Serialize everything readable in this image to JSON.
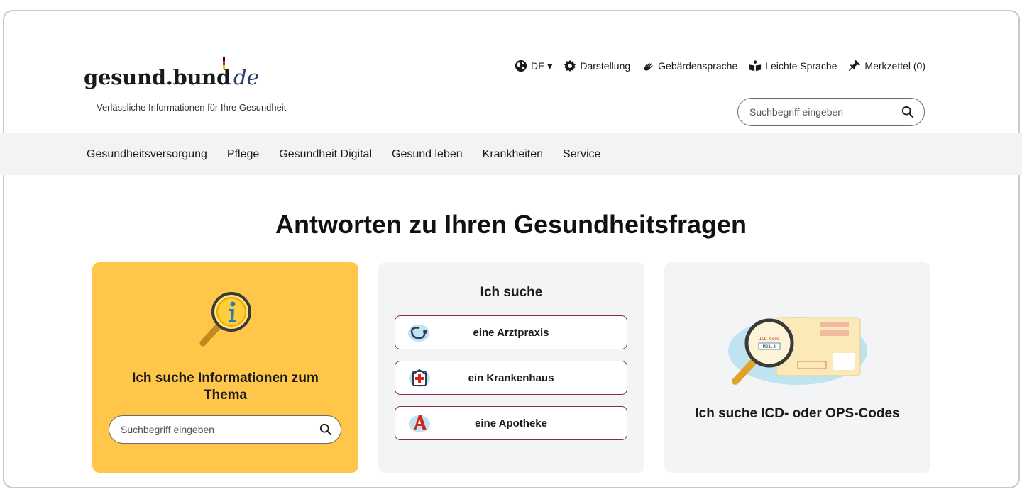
{
  "logo": {
    "word": "gesund.bund",
    "tld": "de",
    "tagline": "Verlässliche Informationen für Ihre Gesundheit"
  },
  "utility": [
    {
      "label": "DE ▾",
      "icon": "globe-icon"
    },
    {
      "label": "Darstellung",
      "icon": "gear-icon"
    },
    {
      "label": "Gebärdensprache",
      "icon": "sign-language-icon"
    },
    {
      "label": "Leichte Sprache",
      "icon": "easy-language-icon"
    },
    {
      "label": "Merkzettel (0)",
      "icon": "pin-icon"
    }
  ],
  "search_top": {
    "placeholder": "Suchbegriff eingeben"
  },
  "nav": [
    "Gesundheitsversorgung",
    "Pflege",
    "Gesundheit Digital",
    "Gesund leben",
    "Krankheiten",
    "Service"
  ],
  "headline": "Antworten zu Ihren Gesundheitsfragen",
  "cards": {
    "info": {
      "title": "Ich suche Informationen zum Thema",
      "search_placeholder": "Suchbegriff eingeben"
    },
    "finder": {
      "title": "Ich suche",
      "options": [
        {
          "label": "eine Arztpraxis",
          "icon": "stethoscope-icon"
        },
        {
          "label": "ein Krankenhaus",
          "icon": "hospital-icon"
        },
        {
          "label": "eine Apotheke",
          "icon": "pharmacy-icon"
        }
      ]
    },
    "codes": {
      "title": "Ich suche ICD- oder OPS-Codes",
      "illustration_text": [
        "ICD-Code",
        "M23.3"
      ]
    }
  },
  "colors": {
    "accent_yellow": "#ffc64a",
    "choice_border": "#8b2a49",
    "nav_bg": "#f2f3f4"
  }
}
